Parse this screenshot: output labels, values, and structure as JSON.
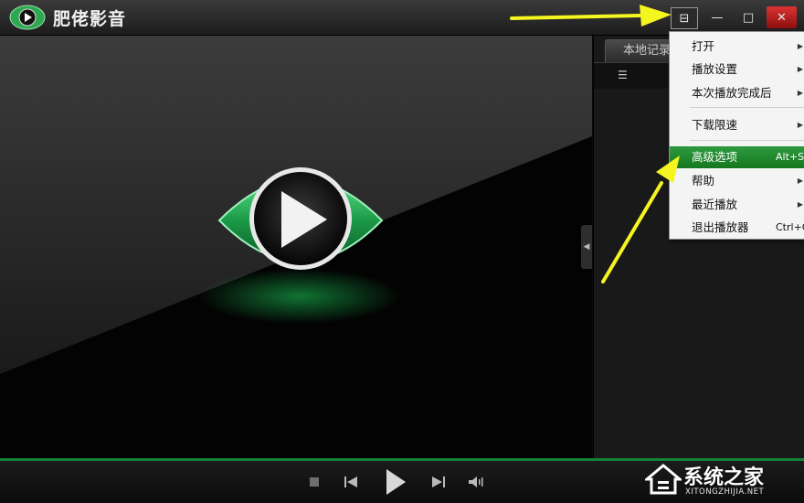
{
  "app": {
    "title": "肥佬影音"
  },
  "window_controls": {
    "menu": "⊟",
    "minimize": "—",
    "maximize": "□",
    "close": "✕"
  },
  "side_panel": {
    "tab_label": "本地记录"
  },
  "context_menu": {
    "items": [
      {
        "label": "打开",
        "shortcut": "",
        "submenu": true
      },
      {
        "label": "播放设置",
        "shortcut": "",
        "submenu": true
      },
      {
        "label": "本次播放完成后",
        "shortcut": "",
        "submenu": true
      },
      {
        "label": "下载限速",
        "shortcut": "",
        "submenu": true
      },
      {
        "label": "高级选项",
        "shortcut": "Alt+S",
        "submenu": false,
        "highlighted": true
      },
      {
        "label": "帮助",
        "shortcut": "",
        "submenu": true
      },
      {
        "label": "最近播放",
        "shortcut": "",
        "submenu": true
      },
      {
        "label": "退出播放器",
        "shortcut": "Ctrl+Q",
        "submenu": false
      }
    ]
  },
  "watermark": {
    "text": "系统之家",
    "url": "XITONGZHIJIA.NET"
  },
  "colors": {
    "accent_green": "#16a04a",
    "highlight_green": "#1f8a2d",
    "arrow_yellow": "#f5f520"
  }
}
